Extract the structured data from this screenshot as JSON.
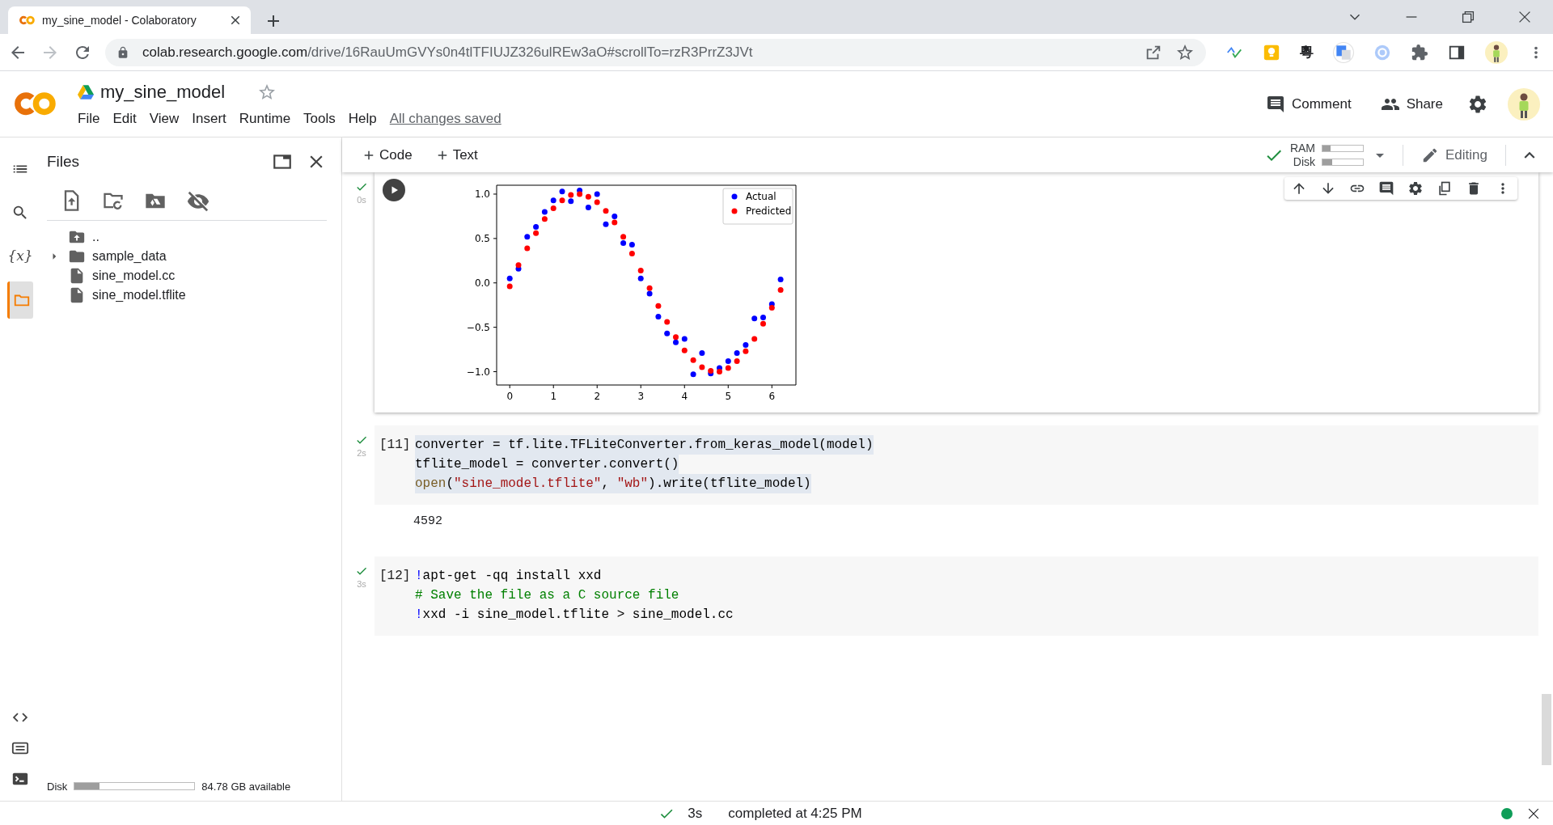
{
  "browser": {
    "tab": {
      "title": "my_sine_model - Colaboratory",
      "selected": true
    },
    "forward": {
      "disabled": true
    },
    "url": {
      "host": "colab.research.google.com",
      "path": "/drive/16RauUmGVYs0n4tlTFIUJZ326ulREw3aO#scrollTo=rzR3PrrZ3JVt"
    },
    "extension_glyph": "粵"
  },
  "notebook": {
    "title": "my_sine_model",
    "starred": false,
    "menu": [
      "File",
      "Edit",
      "View",
      "Insert",
      "Runtime",
      "Tools",
      "Help"
    ],
    "save_status": "All changes saved"
  },
  "header_actions": [
    {
      "kind": "comment",
      "label": "Comment"
    },
    {
      "kind": "share",
      "label": "Share"
    }
  ],
  "sidebar": {
    "rail": [
      {
        "kind": "toc",
        "selected": false
      },
      {
        "kind": "search",
        "selected": false
      },
      {
        "kind": "variables",
        "glyph": "{x}",
        "selected": false
      },
      {
        "kind": "files",
        "selected": true
      }
    ],
    "files": {
      "title": "Files",
      "tree": [
        {
          "kind": "parent",
          "name": ".."
        },
        {
          "kind": "folder",
          "name": "sample_data",
          "expanded": false
        },
        {
          "kind": "file",
          "name": "sine_model.cc"
        },
        {
          "kind": "file",
          "name": "sine_model.tflite"
        }
      ],
      "disk": {
        "label": "Disk",
        "level": 0.21,
        "reading": "84.78 GB available"
      }
    }
  },
  "toolbar": {
    "add": [
      "Code",
      "Text"
    ],
    "connected": true,
    "ram": {
      "label": "RAM",
      "level": 0.2
    },
    "disk": {
      "label": "Disk",
      "level": 0.24
    },
    "mode": "Editing"
  },
  "cells": [
    {
      "kind": "chart",
      "status": "0s",
      "chart_data": {
        "type": "scatter",
        "x": [
          0,
          0.2,
          0.4,
          0.6,
          0.8,
          1.0,
          1.2,
          1.4,
          1.6,
          1.8,
          2.0,
          2.2,
          2.4,
          2.6,
          2.8,
          3.0,
          3.2,
          3.4,
          3.6,
          3.8,
          4.0,
          4.2,
          4.4,
          4.6,
          4.8,
          5.0,
          5.2,
          5.4,
          5.6,
          5.8,
          6.0,
          6.2
        ],
        "series": [
          {
            "name": "Actual",
            "color": "#0000ff",
            "values": [
              0.05,
              0.16,
              0.52,
              0.63,
              0.8,
              0.93,
              1.03,
              0.92,
              1.04,
              0.85,
              1.0,
              0.66,
              0.75,
              0.45,
              0.43,
              0.05,
              -0.12,
              -0.38,
              -0.57,
              -0.67,
              -0.63,
              -1.03,
              -0.79,
              -1.02,
              -0.96,
              -0.88,
              -0.79,
              -0.7,
              -0.4,
              -0.39,
              -0.24,
              0.04
            ]
          },
          {
            "name": "Predicted",
            "color": "#ff0000",
            "values": [
              -0.04,
              0.2,
              0.39,
              0.56,
              0.72,
              0.84,
              0.93,
              0.99,
              1.0,
              0.97,
              0.91,
              0.81,
              0.68,
              0.52,
              0.33,
              0.14,
              -0.06,
              -0.26,
              -0.44,
              -0.61,
              -0.76,
              -0.87,
              -0.95,
              -0.99,
              -1.0,
              -0.96,
              -0.88,
              -0.77,
              -0.63,
              -0.46,
              -0.28,
              -0.08
            ]
          }
        ],
        "legend": "upper right",
        "xlim": [
          -0.3,
          6.55
        ],
        "ylim": [
          -1.15,
          1.1
        ],
        "xticks": [
          0,
          1,
          2,
          3,
          4,
          5,
          6
        ],
        "yticks": [
          {
            "value": -1,
            "label": "−1.0"
          },
          {
            "value": -0.5,
            "label": "−0.5"
          },
          {
            "value": 0,
            "label": "0.0"
          },
          {
            "value": 0.5,
            "label": "0.5"
          },
          {
            "value": 1,
            "label": "1.0"
          }
        ]
      }
    },
    {
      "kind": "code",
      "count": "[11]",
      "status": "2s",
      "lines": [
        {
          "selected": true,
          "tokens": [
            {
              "kind": "plain",
              "text": "converter = tf.lite.TFLiteConverter.from_keras_model(model)"
            }
          ]
        },
        {
          "selected": true,
          "tokens": [
            {
              "kind": "plain",
              "text": "tflite_model = converter.convert()"
            }
          ]
        },
        {
          "selected": true,
          "tokens": [
            {
              "kind": "builtin",
              "text": "open"
            },
            {
              "kind": "plain",
              "text": "("
            },
            {
              "kind": "string",
              "text": "\"sine_model.tflite\""
            },
            {
              "kind": "plain",
              "text": ", "
            },
            {
              "kind": "string",
              "text": "\"wb\""
            },
            {
              "kind": "plain",
              "text": ").write(tflite_model)"
            }
          ]
        }
      ],
      "output": "4592"
    },
    {
      "kind": "code",
      "count": "[12]",
      "status": "3s",
      "lines": [
        {
          "selected": false,
          "tokens": [
            {
              "kind": "bang",
              "text": "!"
            },
            {
              "kind": "plain",
              "text": "apt-get -qq install xxd"
            }
          ]
        },
        {
          "selected": false,
          "tokens": [
            {
              "kind": "comment",
              "text": "# Save the file as a C source file"
            }
          ]
        },
        {
          "selected": false,
          "tokens": [
            {
              "kind": "bang",
              "text": "!"
            },
            {
              "kind": "plain",
              "text": "xxd -i sine_model.tflite > sine_model.cc"
            }
          ]
        }
      ]
    }
  ],
  "status_bar": {
    "duration": "3s",
    "message": "completed at 4:25 PM",
    "connected": true
  }
}
